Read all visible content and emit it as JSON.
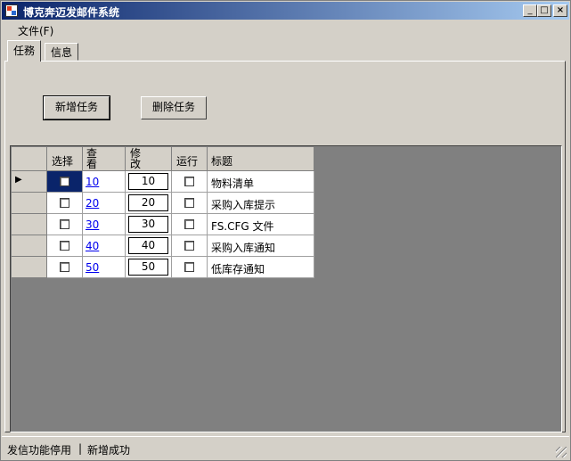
{
  "window": {
    "title": "博克奔迈发邮件系统",
    "minimize": "_",
    "maximize": "□",
    "close": "×"
  },
  "menu": {
    "file": "文件(F)"
  },
  "tabs": [
    {
      "label": "任務"
    },
    {
      "label": "信息"
    }
  ],
  "toolbar": {
    "add_task": "新增任务",
    "delete_task": "删除任务"
  },
  "grid": {
    "headers": {
      "select": "选择",
      "view": "查看",
      "modify": "修改",
      "run": "运行",
      "title": "标题"
    },
    "current_row_marker": "▶",
    "rows": [
      {
        "view": "10",
        "modify": "10",
        "title": "物料清单"
      },
      {
        "view": "20",
        "modify": "20",
        "title": "采购入库提示"
      },
      {
        "view": "30",
        "modify": "30",
        "title": "FS.CFG 文件"
      },
      {
        "view": "40",
        "modify": "40",
        "title": "采购入库通知"
      },
      {
        "view": "50",
        "modify": "50",
        "title": "低库存通知"
      }
    ]
  },
  "status": {
    "left": "发信功能停用",
    "separator": "|",
    "right": "新增成功"
  }
}
